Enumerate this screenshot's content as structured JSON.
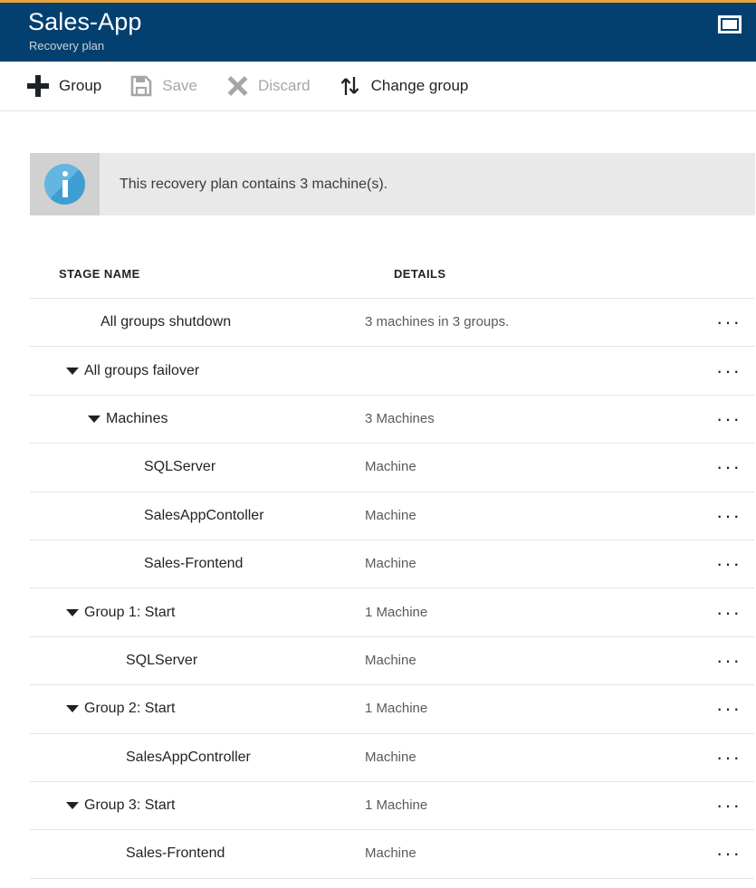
{
  "header": {
    "title": "Sales-App",
    "subtitle": "Recovery plan",
    "window_icon": "restore-window-icon",
    "background_color": "#04406f",
    "accent_color": "#e8a33d"
  },
  "commandbar": {
    "items": [
      {
        "label": "Group",
        "icon": "plus-icon",
        "enabled": true
      },
      {
        "label": "Save",
        "icon": "save-icon",
        "enabled": false
      },
      {
        "label": "Discard",
        "icon": "close-x-icon",
        "enabled": false
      },
      {
        "label": "Change group",
        "icon": "swap-arrows-icon",
        "enabled": true
      }
    ]
  },
  "info_banner": {
    "icon": "info-icon",
    "message": "This recovery plan contains 3 machine(s).",
    "icon_color": "#4fa8d8",
    "background_color": "#e9e9e9"
  },
  "table": {
    "columns": {
      "stage_name": "STAGE NAME",
      "details": "DETAILS"
    },
    "row_menu_label": "···",
    "rows": [
      {
        "name": "All groups shutdown",
        "details": "3 machines in 3 groups.",
        "indent": 0,
        "caret": false
      },
      {
        "name": "All groups failover",
        "details": "",
        "indent": 1,
        "caret": true
      },
      {
        "name": "Machines",
        "details": "3 Machines",
        "indent": 2,
        "caret": true
      },
      {
        "name": "SQLServer",
        "details": "Machine",
        "indent": 3,
        "caret": false
      },
      {
        "name": "SalesAppContoller",
        "details": "Machine",
        "indent": 3,
        "caret": false
      },
      {
        "name": "Sales-Frontend",
        "details": "Machine",
        "indent": 3,
        "caret": false
      },
      {
        "name": "Group 1: Start",
        "details": "1 Machine",
        "indent": 1,
        "caret": true
      },
      {
        "name": "SQLServer",
        "details": "Machine",
        "indent": 4,
        "caret": false
      },
      {
        "name": "Group 2: Start",
        "details": "1 Machine",
        "indent": 1,
        "caret": true
      },
      {
        "name": "SalesAppController",
        "details": "Machine",
        "indent": 4,
        "caret": false
      },
      {
        "name": "Group 3: Start",
        "details": "1 Machine",
        "indent": 1,
        "caret": true
      },
      {
        "name": "Sales-Frontend",
        "details": "Machine",
        "indent": 4,
        "caret": false
      }
    ]
  }
}
